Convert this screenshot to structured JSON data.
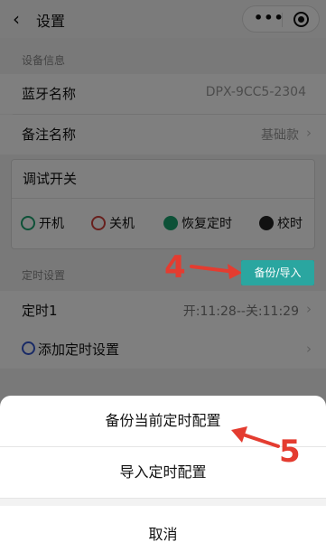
{
  "navbar": {
    "back_icon": "‹",
    "title": "设置",
    "more_icon": "•••"
  },
  "device_info": {
    "section_label": "设备信息",
    "bluetooth_name_label": "蓝牙名称",
    "bluetooth_name_value": "DPX-9CC5-2304",
    "note_name_label": "备注名称",
    "note_name_value": "基础款"
  },
  "debug": {
    "title": "调试开关",
    "power_on": "开机",
    "power_off": "关机",
    "restore_timer": "恢复定时",
    "calibrate": "校时"
  },
  "timer": {
    "section_label": "定时设置",
    "backup_button": "备份/导入",
    "timer1_label": "定时1",
    "timer1_value": "开:11:28--关:11:29",
    "add_label": "添加定时设置"
  },
  "annotations": {
    "step4": "4",
    "step5": "5"
  },
  "action_sheet": {
    "backup_current": "备份当前定时配置",
    "import_config": "导入定时配置",
    "cancel": "取消"
  },
  "colors": {
    "accent": "#2aa6a0",
    "annotation": "#e43c30"
  }
}
